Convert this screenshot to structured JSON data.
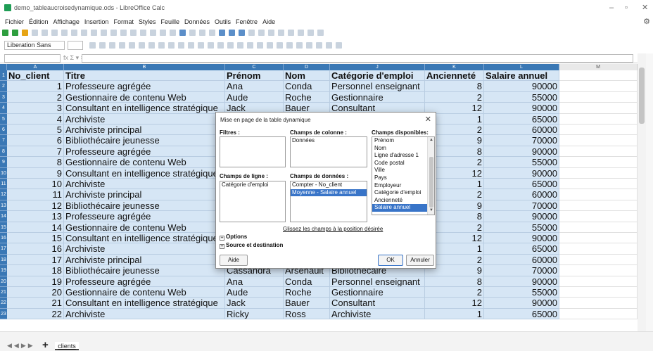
{
  "window": {
    "title": "demo_tableaucroisedynamique.ods - LibreOffice Calc",
    "controls": [
      "–",
      "▫",
      "✕"
    ]
  },
  "menu": [
    "Fichier",
    "Édition",
    "Affichage",
    "Insertion",
    "Format",
    "Styles",
    "Feuille",
    "Données",
    "Outils",
    "Fenêtre",
    "Aide"
  ],
  "toolbar": {
    "font_name": "Liberation Sans",
    "fx_label": "fx Σ ▾ ="
  },
  "columns": [
    "A",
    "B",
    "C",
    "D",
    "J",
    "K",
    "L",
    "M"
  ],
  "header_row": [
    "No_client",
    "Titre",
    "Prénom",
    "Nom",
    "Catégorie d'emploi",
    "Ancienneté",
    "Salaire annuel"
  ],
  "rows": [
    {
      "n": "2",
      "a": "1",
      "b": "Professeure agrégée",
      "c": "Ana",
      "d": "Conda",
      "j": "Personnel enseignant",
      "k": "8",
      "l": "90000"
    },
    {
      "n": "3",
      "a": "2",
      "b": "Gestionnaire de contenu Web",
      "c": "Aude",
      "d": "Roche",
      "j": "Gestionnaire",
      "k": "2",
      "l": "55000"
    },
    {
      "n": "4",
      "a": "3",
      "b": "Consultant en intelligence stratégique",
      "c": "Jack",
      "d": "Bauer",
      "j": "Consultant",
      "k": "12",
      "l": "90000"
    },
    {
      "n": "5",
      "a": "4",
      "b": "Archiviste",
      "c": "",
      "d": "",
      "j": "",
      "k": "1",
      "l": "65000"
    },
    {
      "n": "6",
      "a": "5",
      "b": "Archiviste principal",
      "c": "",
      "d": "",
      "j": "",
      "k": "2",
      "l": "60000"
    },
    {
      "n": "7",
      "a": "6",
      "b": "Bibliothécaire jeunesse",
      "c": "",
      "d": "",
      "j": "",
      "k": "9",
      "l": "70000"
    },
    {
      "n": "8",
      "a": "7",
      "b": "Professeure agrégée",
      "c": "",
      "d": "",
      "j": "",
      "k": "8",
      "l": "90000"
    },
    {
      "n": "9",
      "a": "8",
      "b": "Gestionnaire de contenu Web",
      "c": "",
      "d": "",
      "j": "",
      "k": "2",
      "l": "55000"
    },
    {
      "n": "10",
      "a": "9",
      "b": "Consultant en intelligence stratégique",
      "c": "",
      "d": "",
      "j": "",
      "k": "12",
      "l": "90000"
    },
    {
      "n": "11",
      "a": "10",
      "b": "Archiviste",
      "c": "",
      "d": "",
      "j": "",
      "k": "1",
      "l": "65000"
    },
    {
      "n": "12",
      "a": "11",
      "b": "Archiviste principal",
      "c": "",
      "d": "",
      "j": "",
      "k": "2",
      "l": "60000"
    },
    {
      "n": "13",
      "a": "12",
      "b": "Bibliothécaire jeunesse",
      "c": "",
      "d": "",
      "j": "",
      "k": "9",
      "l": "70000"
    },
    {
      "n": "14",
      "a": "13",
      "b": "Professeure agrégée",
      "c": "",
      "d": "",
      "j": "",
      "k": "8",
      "l": "90000"
    },
    {
      "n": "15",
      "a": "14",
      "b": "Gestionnaire de contenu Web",
      "c": "",
      "d": "",
      "j": "",
      "k": "2",
      "l": "55000"
    },
    {
      "n": "16",
      "a": "15",
      "b": "Consultant en intelligence stratégique",
      "c": "",
      "d": "",
      "j": "",
      "k": "12",
      "l": "90000"
    },
    {
      "n": "17",
      "a": "16",
      "b": "Archiviste",
      "c": "",
      "d": "",
      "j": "",
      "k": "1",
      "l": "65000"
    },
    {
      "n": "18",
      "a": "17",
      "b": "Archiviste principal",
      "c": "",
      "d": "",
      "j": "",
      "k": "2",
      "l": "60000"
    },
    {
      "n": "19",
      "a": "18",
      "b": "Bibliothécaire jeunesse",
      "c": "Cassandra",
      "d": "Arsenault",
      "j": "Bibliothécaire",
      "k": "9",
      "l": "70000"
    },
    {
      "n": "20",
      "a": "19",
      "b": "Professeure agrégée",
      "c": "Ana",
      "d": "Conda",
      "j": "Personnel enseignant",
      "k": "8",
      "l": "90000"
    },
    {
      "n": "21",
      "a": "20",
      "b": "Gestionnaire de contenu Web",
      "c": "Aude",
      "d": "Roche",
      "j": "Gestionnaire",
      "k": "2",
      "l": "55000"
    },
    {
      "n": "22",
      "a": "21",
      "b": "Consultant en intelligence stratégique",
      "c": "Jack",
      "d": "Bauer",
      "j": "Consultant",
      "k": "12",
      "l": "90000"
    },
    {
      "n": "23",
      "a": "22",
      "b": "Archiviste",
      "c": "Ricky",
      "d": "Ross",
      "j": "Archiviste",
      "k": "1",
      "l": "65000"
    }
  ],
  "sheet_tab": "clients",
  "dialog": {
    "title": "Mise en page de la table dynamique",
    "close": "✕",
    "filters_label": "Filtres :",
    "column_fields_label": "Champs de colonne :",
    "column_fields": [
      "Données"
    ],
    "available_label": "Champs disponibles:",
    "available_fields": [
      "Prénom",
      "Nom",
      "Ligne d'adresse 1",
      "Code postal",
      "Ville",
      "Pays",
      "Employeur",
      "Catégorie d'emploi",
      "Ancienneté",
      "Salaire annuel"
    ],
    "available_selected": "Salaire annuel",
    "row_fields_label": "Champs de ligne :",
    "row_fields": [
      "Catégorie d'emploi"
    ],
    "data_fields_label": "Champs de données :",
    "data_fields": [
      "Compter - No_client",
      "Moyenne - Salaire annuel"
    ],
    "data_selected": "Moyenne - Salaire annuel",
    "hint": "Glissez les champs à la position désirée",
    "options_label": "Options",
    "source_label": "Source et destination",
    "help_button": "Aide",
    "ok_button": "OK",
    "cancel_button": "Annuler"
  }
}
